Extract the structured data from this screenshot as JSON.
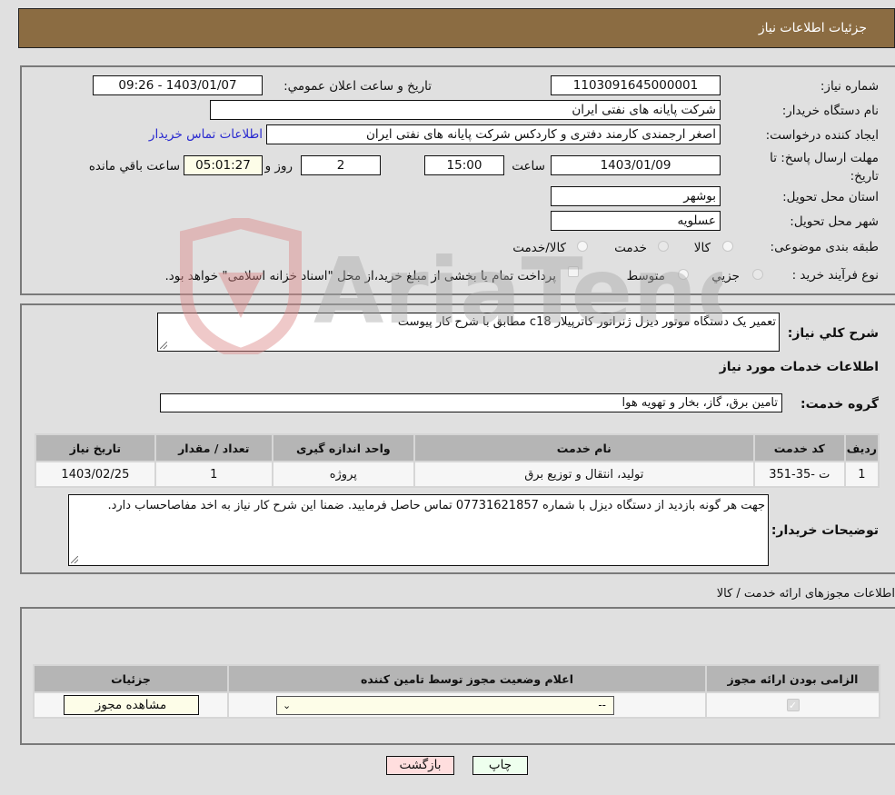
{
  "header": {
    "title": "جزئيات اطلاعات نياز"
  },
  "fields": {
    "need_number": {
      "label": "شماره نياز:",
      "value": "1103091645000001"
    },
    "announce_datetime": {
      "label": "تاريخ و ساعت اعلان عمومي:",
      "value": "1403/01/07 - 09:26"
    },
    "buyer_org": {
      "label": "نام دستگاه خريدار:",
      "value": "شرکت پایانه های نفتی ایران"
    },
    "requester": {
      "label": "ايجاد کننده درخواست:",
      "value": "اصغر ارجمندی کارمند دفتری و کاردکس شرکت پایانه های نفتی ایران"
    },
    "buyer_contact_link": "اطلاعات تماس خريدار",
    "deadline": {
      "label": "مهلت ارسال پاسخ: تا تاريخ:",
      "date": "1403/01/09",
      "time_label": "ساعت",
      "time": "15:00",
      "days": "2",
      "days_label": "روز و",
      "remaining": "05:01:27",
      "remaining_label": "ساعت باقي مانده"
    },
    "province": {
      "label": "استان محل تحويل:",
      "value": "بوشهر"
    },
    "city": {
      "label": "شهر محل تحويل:",
      "value": "عسلویه"
    },
    "category": {
      "label": "طبقه بندی موضوعی:",
      "options": [
        "کالا",
        "خدمت",
        "کالا/خدمت"
      ],
      "selected": "خدمت"
    },
    "purchase_type": {
      "label": "نوع فرآيند خريد :",
      "options": [
        "جزيي",
        "متوسط"
      ],
      "selected": "جزيي",
      "treasury_checkbox_label": "پرداخت تمام يا بخشی از مبلغ خريد،از محل \"اسناد خزانه اسلامی\" خواهد بود.",
      "treasury_checked": false
    }
  },
  "description": {
    "label": "شرح کلي نياز:",
    "value": "تعمیر یک دستگاه موتور دیزل ژنراتور کاترپیلار c18 مطابق با شرح کار پیوست"
  },
  "services_section": {
    "title": "اطلاعات خدمات مورد نياز",
    "group_label": "گروه خدمت:",
    "group_value": "تامين برق، گاز، بخار و تهويه هوا",
    "table": {
      "headers": [
        "رديف",
        "کد خدمت",
        "نام خدمت",
        "واحد اندازه گيری",
        "تعداد / مقدار",
        "تاريخ نياز"
      ],
      "rows": [
        [
          "1",
          "ت -35-351",
          "توليد، انتقال و توزيع برق",
          "پروژه",
          "1",
          "1403/02/25"
        ]
      ]
    }
  },
  "buyer_notes": {
    "label": "توضيحات خريدار:",
    "value": "جهت هر گونه بازدید از دستگاه دیزل با شماره 07731621857 تماس حاصل فرمایید. ضمنا  این شرح کار نیاز به اخد مفاصاحساب دارد."
  },
  "permits_section": {
    "title": "اطلاعات مجوزهای ارائه خدمت / کالا",
    "headers": [
      "الزامی بودن ارائه مجوز",
      "اعلام وضعيت مجوز توسط تامين کننده",
      "جزئيات"
    ],
    "row": {
      "required_checked": true,
      "status_select_value": "--",
      "details_button": "مشاهده مجوز"
    }
  },
  "footer": {
    "print_button": "چاپ",
    "back_button": "بازگشت"
  },
  "watermark": {
    "text": "AriaTender.neT"
  },
  "colors": {
    "header_bg": "#8b6c42",
    "back_button_bg": "#ffdede",
    "print_button_bg": "#eeffee",
    "link": "#2a2ad0"
  }
}
